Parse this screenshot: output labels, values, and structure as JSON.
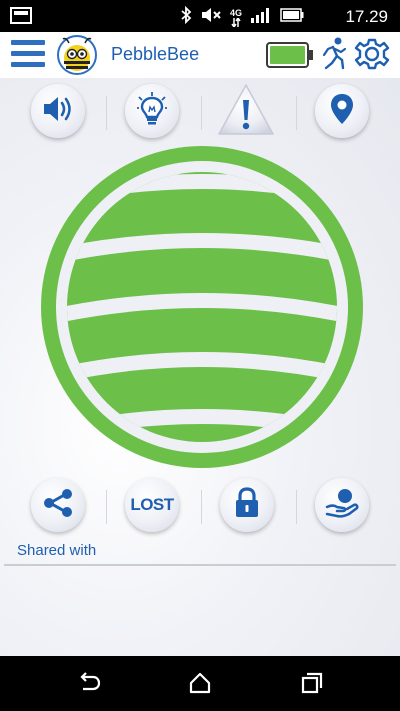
{
  "status_bar": {
    "time": "17.29",
    "network_label": "4G",
    "icons": [
      "screenshot-icon",
      "bluetooth-icon",
      "mute-icon",
      "network-4g-icon",
      "signal-icon",
      "battery-icon"
    ]
  },
  "header": {
    "title": "PebbleBee",
    "icons": [
      "menu-icon",
      "bee-logo",
      "battery-level-icon",
      "runner-icon",
      "gear-icon"
    ],
    "battery_color": "#6cc04a"
  },
  "actions_top": [
    {
      "name": "speaker-icon"
    },
    {
      "name": "lightbulb-icon"
    },
    {
      "name": "alert-icon"
    },
    {
      "name": "location-pin-icon"
    }
  ],
  "actions_bottom": [
    {
      "name": "share-icon"
    },
    {
      "name": "lost-button",
      "label": "LOST"
    },
    {
      "name": "lock-icon"
    },
    {
      "name": "hand-ball-icon"
    }
  ],
  "shared": {
    "label": "Shared with"
  },
  "colors": {
    "accent": "#1f5fb0",
    "green": "#6cc04a",
    "background": "#eceef4"
  },
  "nav": [
    "back-icon",
    "home-icon",
    "recents-icon"
  ]
}
